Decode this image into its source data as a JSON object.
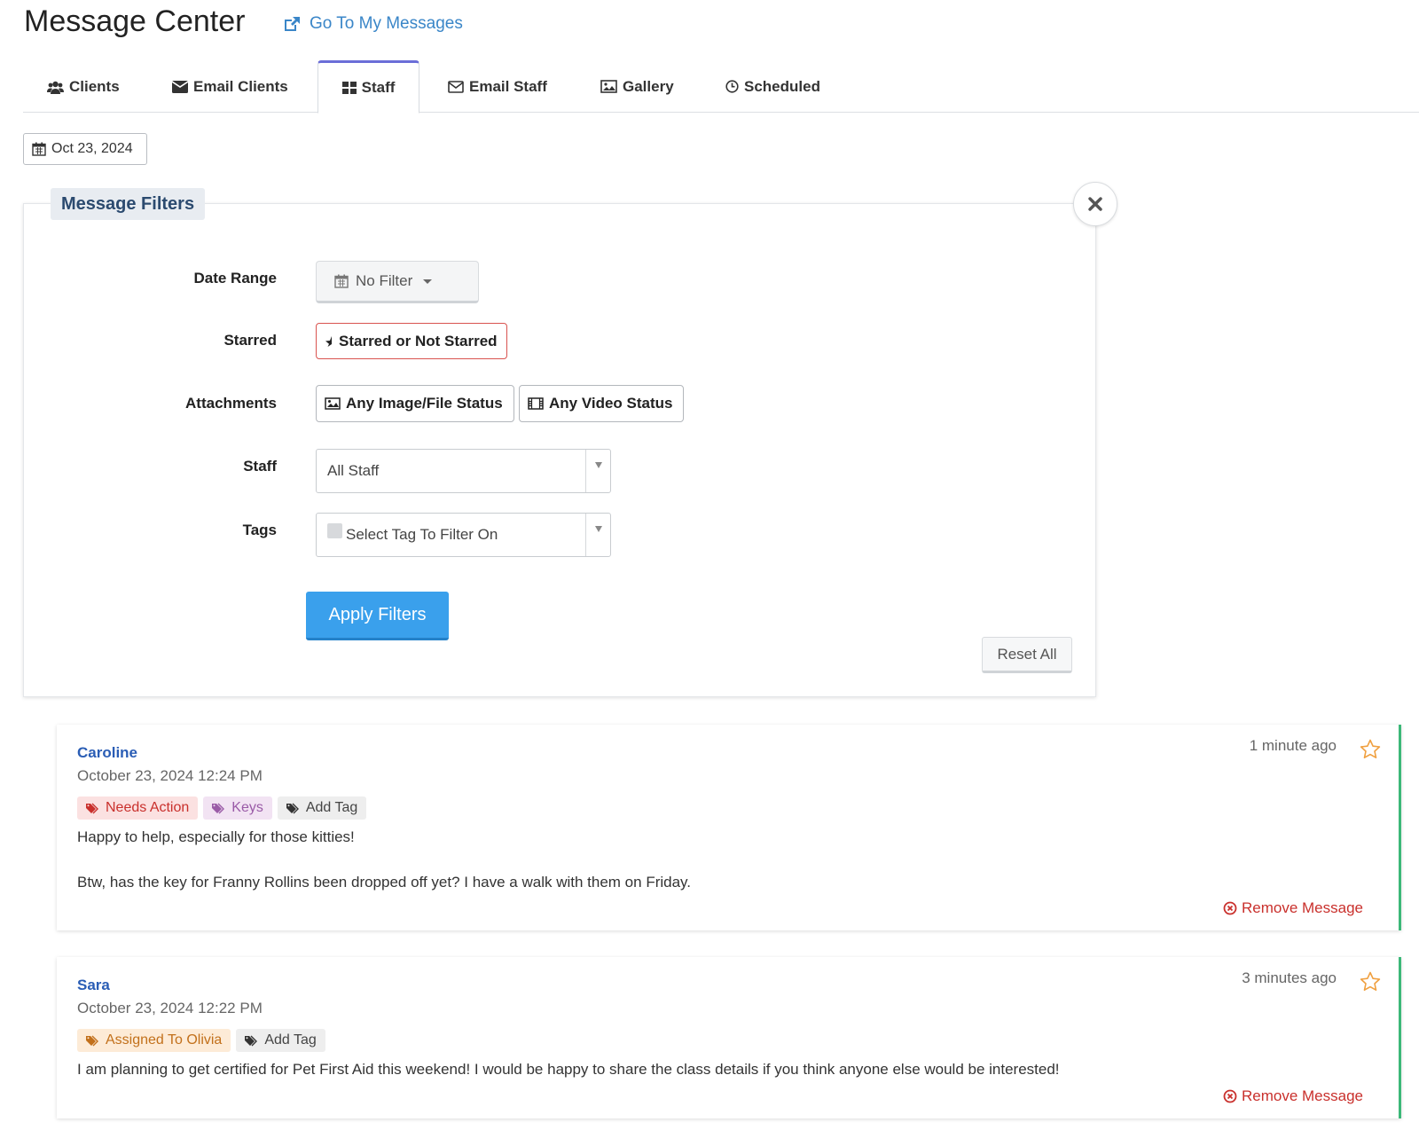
{
  "header": {
    "title": "Message Center",
    "goto_link": "Go To My Messages"
  },
  "tabs": [
    {
      "label": "Clients",
      "icon": "users-icon"
    },
    {
      "label": "Email Clients",
      "icon": "envelope-icon"
    },
    {
      "label": "Staff",
      "icon": "grid-icon",
      "active": true
    },
    {
      "label": "Email Staff",
      "icon": "envelope-outline-icon"
    },
    {
      "label": "Gallery",
      "icon": "image-icon"
    },
    {
      "label": "Scheduled",
      "icon": "clock-icon"
    }
  ],
  "date_chip": "Oct 23, 2024",
  "filters": {
    "legend": "Message Filters",
    "date_range_label": "Date Range",
    "date_range_value": "No Filter",
    "starred_label": "Starred",
    "starred_value": "Starred or Not Starred",
    "attachments_label": "Attachments",
    "image_status": "Any Image/File Status",
    "video_status": "Any Video Status",
    "staff_label": "Staff",
    "staff_value": "All Staff",
    "tags_label": "Tags",
    "tags_placeholder": "Select Tag To Filter On",
    "apply": "Apply Filters",
    "reset": "Reset All"
  },
  "messages": [
    {
      "sender": "Caroline",
      "date": "October 23, 2024 12:24 PM",
      "ago": "1 minute ago",
      "tags": [
        "Needs Action",
        "Keys",
        "Add Tag"
      ],
      "lines": [
        "Happy to help, especially for those kitties!",
        "Btw, has the key for Franny Rollins been dropped off yet? I have a walk with them on Friday."
      ],
      "remove": "Remove Message"
    },
    {
      "sender": "Sara",
      "date": "October 23, 2024 12:22 PM",
      "ago": "3 minutes ago",
      "tags": [
        "Assigned To Olivia",
        "Add Tag"
      ],
      "lines": [
        "I am planning to get certified for Pet First Aid this weekend! I would be happy to share the class details if you think anyone else would be interested!"
      ],
      "remove": "Remove Message"
    }
  ],
  "colors": {
    "link": "#3a86c8",
    "primary": "#3aa0ec",
    "danger": "#c9302c",
    "accent_green": "#3cb878",
    "star": "#f0a040",
    "active_tab": "#6b6ed8"
  }
}
